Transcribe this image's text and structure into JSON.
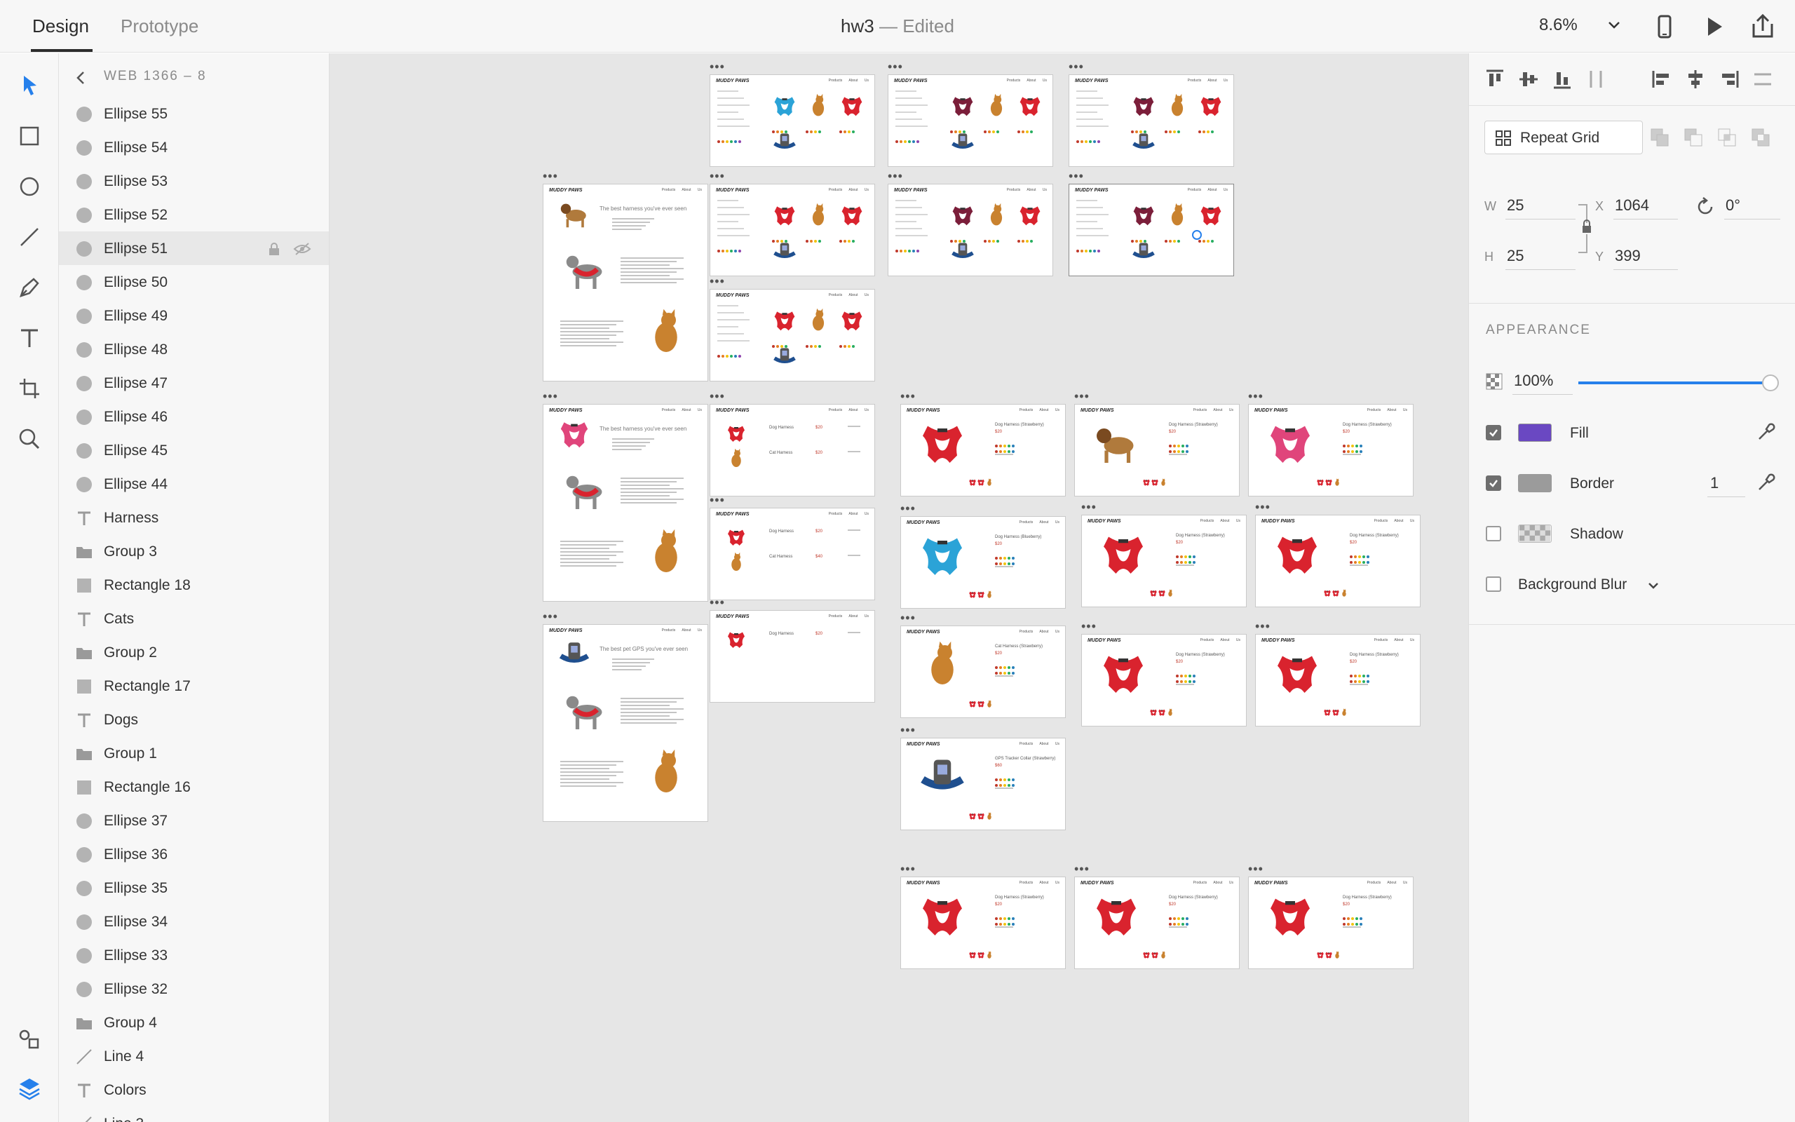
{
  "app": {
    "tabs": {
      "design": "Design",
      "prototype": "Prototype"
    },
    "document": {
      "name": "hw3",
      "separator": "—",
      "status": "Edited"
    },
    "zoom": "8.6%"
  },
  "layers": {
    "breadcrumb": "WEB 1366 – 8",
    "items": [
      {
        "type": "ellipse",
        "label": "Ellipse 55"
      },
      {
        "type": "ellipse",
        "label": "Ellipse 54"
      },
      {
        "type": "ellipse",
        "label": "Ellipse 53"
      },
      {
        "type": "ellipse",
        "label": "Ellipse 52"
      },
      {
        "type": "ellipse",
        "label": "Ellipse 51",
        "selected": true
      },
      {
        "type": "ellipse",
        "label": "Ellipse 50"
      },
      {
        "type": "ellipse",
        "label": "Ellipse 49"
      },
      {
        "type": "ellipse",
        "label": "Ellipse 48"
      },
      {
        "type": "ellipse",
        "label": "Ellipse 47"
      },
      {
        "type": "ellipse",
        "label": "Ellipse 46"
      },
      {
        "type": "ellipse",
        "label": "Ellipse 45"
      },
      {
        "type": "ellipse",
        "label": "Ellipse 44"
      },
      {
        "type": "text",
        "label": "Harness"
      },
      {
        "type": "group",
        "label": "Group 3"
      },
      {
        "type": "rectangle",
        "label": "Rectangle 18"
      },
      {
        "type": "text",
        "label": "Cats"
      },
      {
        "type": "group",
        "label": "Group 2"
      },
      {
        "type": "rectangle",
        "label": "Rectangle 17"
      },
      {
        "type": "text",
        "label": "Dogs"
      },
      {
        "type": "group",
        "label": "Group 1"
      },
      {
        "type": "rectangle",
        "label": "Rectangle 16"
      },
      {
        "type": "ellipse",
        "label": "Ellipse 37"
      },
      {
        "type": "ellipse",
        "label": "Ellipse 36"
      },
      {
        "type": "ellipse",
        "label": "Ellipse 35"
      },
      {
        "type": "ellipse",
        "label": "Ellipse 34"
      },
      {
        "type": "ellipse",
        "label": "Ellipse 33"
      },
      {
        "type": "ellipse",
        "label": "Ellipse 32"
      },
      {
        "type": "group",
        "label": "Group 4"
      },
      {
        "type": "line",
        "label": "Line 4"
      },
      {
        "type": "text",
        "label": "Colors"
      },
      {
        "type": "line",
        "label": "Line 3"
      }
    ]
  },
  "canvas": {
    "brand": "MUDDY PAWS",
    "nav": "Products About Us",
    "headlines": {
      "harness": "The best harness you've ever seen",
      "gps": "The best pet GPS you've ever seen"
    },
    "products": {
      "dog_harness": "Dog Harness",
      "cat_harness": "Cat Harness",
      "dog_harness_strawberry": "Dog Harness (Strawberry)",
      "dog_harness_blueberry": "Dog Harness (Blueberry)",
      "cat_harness_strawberry": "Cat Harness (Strawberry)",
      "gps_collar_strawberry": "GPS Tracker Collar (Strawberry)"
    },
    "prices": {
      "p20": "$20",
      "p40": "$40",
      "p60": "$60"
    }
  },
  "properties": {
    "repeat_grid": "Repeat Grid",
    "w_label": "W",
    "w": "25",
    "h_label": "H",
    "h": "25",
    "x_label": "X",
    "x": "1064",
    "y_label": "Y",
    "y": "399",
    "rotation": "0°",
    "appearance": "APPEARANCE",
    "opacity": "100%",
    "opacity_level": 1.0,
    "fill": {
      "label": "Fill",
      "checked": true,
      "color": "#6a48c2"
    },
    "border": {
      "label": "Border",
      "checked": true,
      "color": "#9b9b9b",
      "width": "1"
    },
    "shadow": {
      "label": "Shadow",
      "checked": false
    },
    "background_blur": {
      "label": "Background Blur",
      "checked": false
    }
  },
  "colors": {
    "accent": "#2680eb",
    "harness_red": "#d9232e",
    "harness_blue": "#2ba3d7",
    "harness_pink": "#e0457b"
  }
}
